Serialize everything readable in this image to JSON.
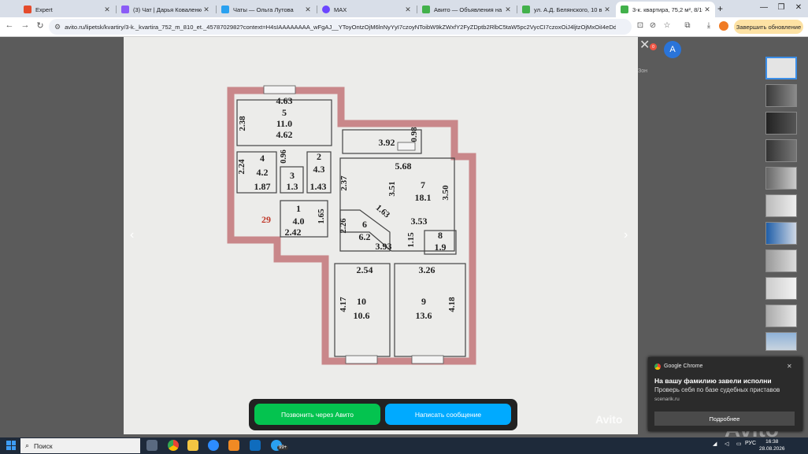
{
  "browser": {
    "tabs": [
      {
        "title": "Expert",
        "color": "#e44b2c"
      },
      {
        "title": "(3) Чат | Дарья Коваленко | М",
        "color": "#8b5cf6"
      },
      {
        "title": "Чаты — Ольга Лутова",
        "color": "#2aa1f0"
      },
      {
        "title": "MAX",
        "color": "#6b46ff"
      },
      {
        "title": "Авито — Объявления на сайт",
        "color": "#42b14b"
      },
      {
        "title": "ул. А.Д. Белянского, 10 в Лип",
        "color": "#42b14b"
      },
      {
        "title": "3-к. квартира, 75,2 м², 8/10 эт",
        "color": "#42b14b"
      }
    ],
    "url": "avito.ru/lipetsk/kvartiry/3-k._kvartira_752_m_810_et._4578702982?context=H4sIAAAAAAAA_wFgAJ__YToyOntzOjM6lnNyYyI7czoyNToibW9kZWxfY2FyZDptb2RlbC5taW5pc2VycCI7czoxOiJ4ljtzOjMxOiI4eDdyN2p3ZnYy...",
    "update_label": "Завершить обновление"
  },
  "floorplan": {
    "rooms": [
      {
        "id": "5",
        "area": "11.0",
        "dims": [
          "4.63",
          "4.62",
          "2.38"
        ]
      },
      {
        "id": "4",
        "area": "4.2",
        "dims": [
          "2.24",
          "1.87"
        ]
      },
      {
        "id": "3",
        "area": "1.3",
        "dims": [
          "0.96"
        ]
      },
      {
        "id": "2",
        "area": "4.3",
        "dims": [
          "1.43"
        ]
      },
      {
        "id": "1",
        "area": "4.0",
        "dims": [
          "1.65",
          "2.42"
        ]
      },
      {
        "id": "7",
        "area": "18.1",
        "dims": [
          "3.92",
          "0.98",
          "5.68",
          "2.37",
          "3.51",
          "3.50",
          "3.53"
        ]
      },
      {
        "id": "6",
        "area": "6.2",
        "dims": [
          "1.63",
          "2.26",
          "3.93",
          "1.15"
        ]
      },
      {
        "id": "8",
        "area": "1.9",
        "dims": []
      },
      {
        "id": "10",
        "area": "10.6",
        "dims": [
          "2.54",
          "4.17"
        ]
      },
      {
        "id": "9",
        "area": "13.6",
        "dims": [
          "3.26",
          "4.18"
        ]
      }
    ],
    "apartment_no": "29"
  },
  "page": {
    "avatar_letter": "А",
    "badge_count": "0",
    "side_text": "Зон",
    "call_button": "Позвонить через Авито",
    "message_button": "Написать сообщение",
    "watermark": "Avito"
  },
  "notification": {
    "app": "Google Chrome",
    "title": "На вашу фамилию завели исполни",
    "body": "Проверь себя по базе судебных приставов",
    "source": "scenarik.ru",
    "more_label": "Подробнее"
  },
  "taskbar": {
    "search_label": "Поиск",
    "badge": "99+",
    "lang": "РУС",
    "time": "16:38",
    "date": "28.08.2026"
  }
}
